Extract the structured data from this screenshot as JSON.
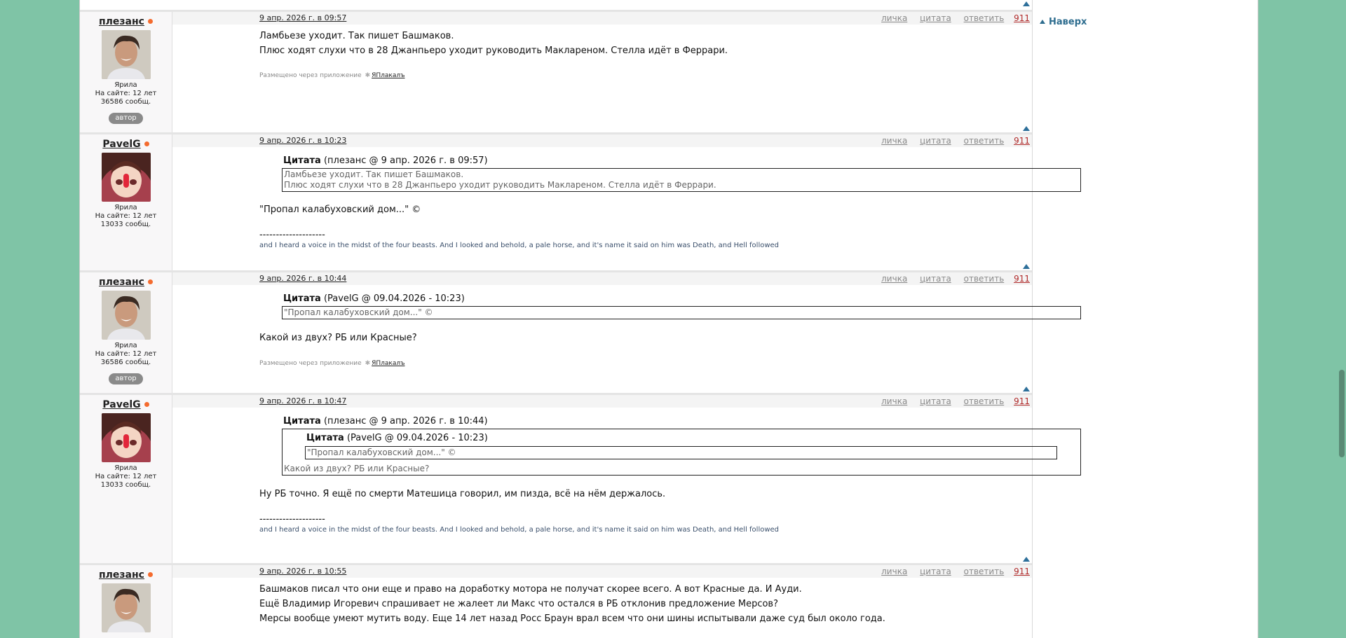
{
  "navigation": {
    "to_top": "Наверх"
  },
  "posts": [
    {
      "author": "плезанс",
      "date": "9 апр. 2026 г. в 09:57",
      "rank": "Ярила",
      "on_site": "На сайте: 12 лет",
      "messages": "36586 сообщ.",
      "badge": "автор",
      "actions": {
        "pm": "личка",
        "quote": "цитата",
        "reply": "ответить",
        "number": "911"
      },
      "body": [
        "Ламбьезе уходит. Так пишет Башмаков.",
        "Плюс ходят слухи что в 28 Джанпьеро уходит руководить Маклареном. Стелла идёт в Феррари."
      ],
      "via": "Размещено через приложение",
      "app": "ЯПлакалъ"
    },
    {
      "author": "PavelG",
      "date": "9 апр. 2026 г. в 10:23",
      "rank": "Ярила",
      "on_site": "На сайте: 12 лет",
      "messages": "13033 сообщ.",
      "actions": {
        "pm": "личка",
        "quote": "цитата",
        "reply": "ответить",
        "number": "911"
      },
      "quote_label": "Цитата",
      "quote_source": "(плезанс @ 9 апр. 2026 г. в 09:57)",
      "quote_lines": [
        "Ламбьезе уходит. Так пишет Башмаков.",
        "Плюс ходят слухи что в 28 Джанпьеро уходит руководить Маклареном. Стелла идёт в Феррари."
      ],
      "body": "\"Пропал калабуховский дом...\" ©",
      "sig_sep": "--------------------",
      "signature": "and I heard a voice in the midst of the four beasts. And I looked and behold, a pale horse, and it's name it said on him was Death, and Hell followed"
    },
    {
      "author": "плезанс",
      "date": "9 апр. 2026 г. в 10:44",
      "rank": "Ярила",
      "on_site": "На сайте: 12 лет",
      "messages": "36586 сообщ.",
      "badge": "автор",
      "actions": {
        "pm": "личка",
        "quote": "цитата",
        "reply": "ответить",
        "number": "911"
      },
      "quote_label": "Цитата",
      "quote_source": "(PavelG @ 09.04.2026 - 10:23)",
      "quote_lines": [
        "\"Пропал калабуховский дом...\" ©"
      ],
      "body": "Какой из двух? РБ или Красные?",
      "via": "Размещено через приложение",
      "app": "ЯПлакалъ"
    },
    {
      "author": "PavelG",
      "date": "9 апр. 2026 г. в 10:47",
      "rank": "Ярила",
      "on_site": "На сайте: 12 лет",
      "messages": "13033 сообщ.",
      "actions": {
        "pm": "личка",
        "quote": "цитата",
        "reply": "ответить",
        "number": "911"
      },
      "quote_label": "Цитата",
      "quote_source": "(плезанс @ 9 апр. 2026 г. в 10:44)",
      "nested_quote_label": "Цитата",
      "nested_quote_source": "(PavelG @ 09.04.2026 - 10:23)",
      "nested_quote_line": "\"Пропал калабуховский дом...\" ©",
      "quote_tail": "Какой из двух? РБ или Красные?",
      "body": "Ну РБ точно. Я ещё по смерти Матешица говорил, им пизда, всё на нём держалось.",
      "sig_sep": "--------------------",
      "signature": "and I heard a voice in the midst of the four beasts. And I looked and behold, a pale horse, and it's name it said on him was Death, and Hell followed"
    },
    {
      "author": "плезанс",
      "date": "9 апр. 2026 г. в 10:55",
      "actions": {
        "pm": "личка",
        "quote": "цитата",
        "reply": "ответить",
        "number": "911"
      },
      "body": [
        "Башмаков писал что они еще и право на доработку мотора не получат скорее всего. А вот Красные да. И Ауди.",
        "Ещё Владимир Игоревич спрашивает не жалеет ли Макс что остался в РБ отклонив предложение Мерсов?",
        "Мерсы вообще умеют мутить воду. Еще 14 лет назад Росс Браун врал всем что они шины испытывали даже суд был около года."
      ]
    }
  ]
}
